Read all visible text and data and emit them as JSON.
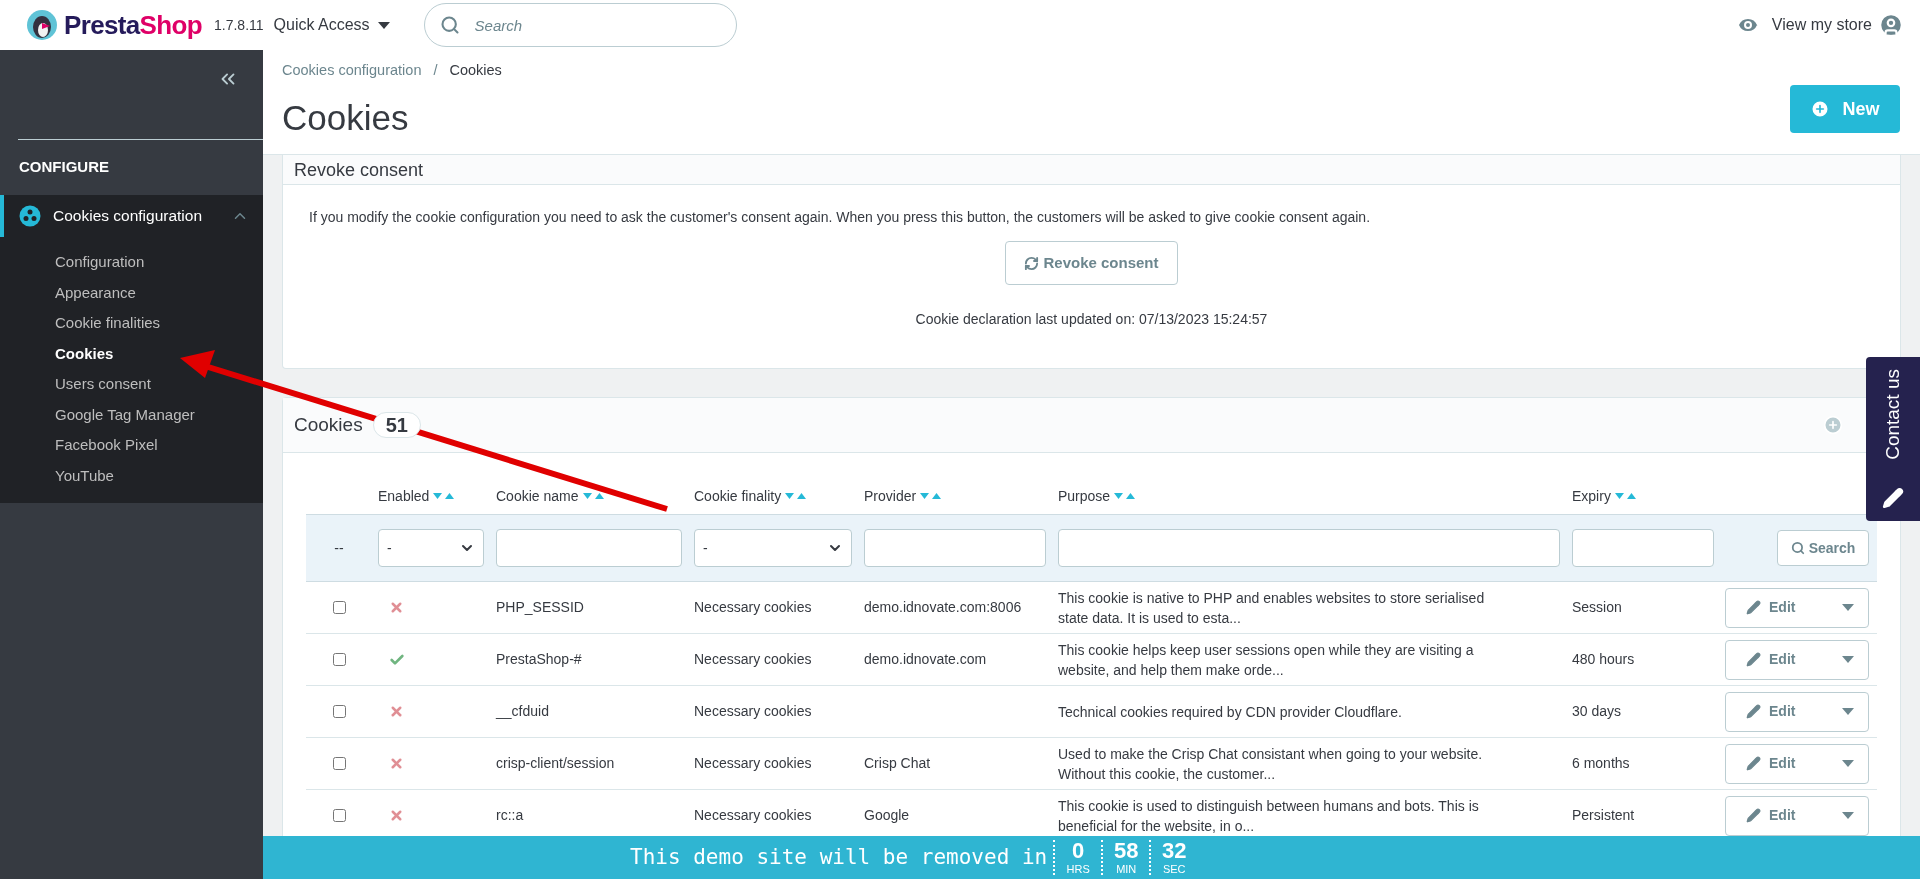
{
  "header": {
    "brand_parts": [
      "Presta",
      "Shop"
    ],
    "version": "1.7.8.11",
    "quick_access": "Quick Access",
    "search": {
      "placeholder": "Search"
    },
    "view_store": "View my store"
  },
  "sidebar": {
    "section": "CONFIGURE",
    "group": {
      "label": "Cookies configuration",
      "expanded": true,
      "items": [
        {
          "label": "Configuration",
          "selected": false
        },
        {
          "label": "Appearance",
          "selected": false
        },
        {
          "label": "Cookie finalities",
          "selected": false
        },
        {
          "label": "Cookies",
          "selected": true
        },
        {
          "label": "Users consent",
          "selected": false
        },
        {
          "label": "Google Tag Manager",
          "selected": false
        },
        {
          "label": "Facebook Pixel",
          "selected": false
        },
        {
          "label": "YouTube",
          "selected": false
        }
      ]
    }
  },
  "breadcrumb": {
    "separator": "/",
    "items": [
      "Cookies configuration",
      "Cookies"
    ]
  },
  "title": "Cookies",
  "new_button": "New",
  "revoke_card": {
    "title": "Revoke consent",
    "text": "If you modify the cookie configuration you need to ask the customer's consent again. When you press this button, the customers will be asked to give cookie consent again.",
    "button": "Revoke consent",
    "updated": "Cookie declaration last updated on: 07/13/2023 15:24:57"
  },
  "cookies_card": {
    "title": "Cookies",
    "count": "51",
    "columns": [
      {
        "label": "Enabled"
      },
      {
        "label": "Cookie name"
      },
      {
        "label": "Cookie finality"
      },
      {
        "label": "Provider"
      },
      {
        "label": "Purpose"
      },
      {
        "label": "Expiry"
      }
    ],
    "filters": {
      "marker": "--",
      "enabled": "-",
      "finality": "-",
      "search_button": "Search"
    },
    "rows": [
      {
        "checked": false,
        "enabled": false,
        "name": "PHP_SESSID",
        "finality": "Necessary cookies",
        "provider": "demo.idnovate.com:8006",
        "purpose": "This cookie is native to PHP and enables websites to store serialised state data. It is used to esta...",
        "expiry": "Session",
        "action": "Edit"
      },
      {
        "checked": false,
        "enabled": true,
        "name": "PrestaShop-#",
        "finality": "Necessary cookies",
        "provider": "demo.idnovate.com",
        "purpose": "This cookie helps keep user sessions open while they are visiting a website, and help them make orde...",
        "expiry": "480 hours",
        "action": "Edit"
      },
      {
        "checked": false,
        "enabled": false,
        "name": "__cfduid",
        "finality": "Necessary cookies",
        "provider": "",
        "purpose": "Technical cookies required by CDN provider Cloudflare.",
        "expiry": "30 days",
        "action": "Edit"
      },
      {
        "checked": false,
        "enabled": false,
        "name": "crisp-client/session",
        "finality": "Necessary cookies",
        "provider": "Crisp Chat",
        "purpose": "Used to make the Crisp Chat consistant when going to your website. Without this cookie, the customer...",
        "expiry": "6 months",
        "action": "Edit"
      },
      {
        "checked": false,
        "enabled": false,
        "name": "rc::a",
        "finality": "Necessary cookies",
        "provider": "Google",
        "purpose": "This cookie is used to distinguish between humans and bots. This is beneficial for the website, in o...",
        "expiry": "Persistent",
        "action": "Edit"
      }
    ]
  },
  "contact_tab": "Contact us",
  "banner": {
    "text": "This demo site will be removed in",
    "counters": [
      {
        "value": "0",
        "unit": "HRS"
      },
      {
        "value": "58",
        "unit": "MIN"
      },
      {
        "value": "32",
        "unit": "SEC"
      }
    ]
  }
}
